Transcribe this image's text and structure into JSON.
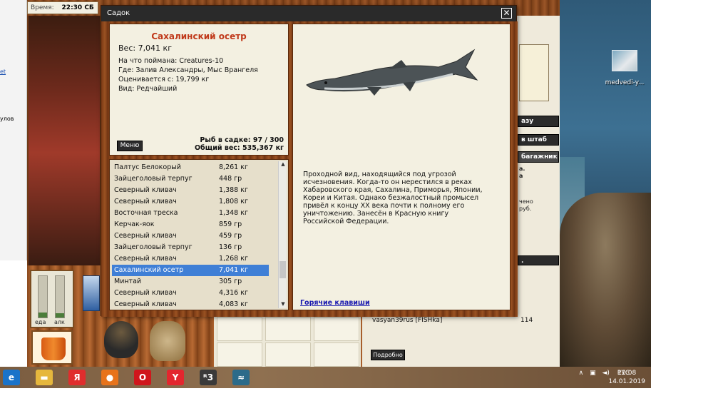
{
  "left_window": {
    "lines": [
      "et",
      "улов"
    ]
  },
  "game": {
    "time_label": "Время:",
    "time_value": "22:30 СБ",
    "gauges": [
      {
        "label": "еда",
        "level": 0.12
      },
      {
        "label": "алк",
        "level": 0.1
      }
    ],
    "right_buttons": [
      "азу",
      "в штаб",
      "багажник"
    ],
    "right_info": [
      "а.",
      "а",
      "чено",
      "руб."
    ],
    "bottom_list": {
      "player": "vasyan39rus [FISHka]",
      "count": "114",
      "button": "Подробно"
    }
  },
  "dialog": {
    "title": "Садок",
    "close_label": "✕",
    "fish": {
      "name": "Сахалинский осетр",
      "weight": "Вес: 7,041 кг",
      "caught_on": "На что поймана: Creatures-10",
      "location": "Где: Залив Александры, Мыс Врангеля",
      "valued": "Оценивается с: 19,799 кг",
      "kind": "Вид: Редчайший"
    },
    "menu_label": "Меню",
    "fish_in_pond": "Рыб в садке: 97 / 300",
    "total_weight": "Общий вес: 535,367 кг",
    "list": [
      {
        "name": "Палтус Белокорый",
        "weight": "8,261 кг"
      },
      {
        "name": "Зайцеголовый терпуг",
        "weight": "448 гр"
      },
      {
        "name": "Северный кливач",
        "weight": "1,388 кг"
      },
      {
        "name": "Северный кливач",
        "weight": "1,808 кг"
      },
      {
        "name": "Восточная треска",
        "weight": "1,348 кг"
      },
      {
        "name": "Керчак-яок",
        "weight": "859 гр"
      },
      {
        "name": "Северный кливач",
        "weight": "459 гр"
      },
      {
        "name": "Зайцеголовый терпуг",
        "weight": "136 гр"
      },
      {
        "name": "Северный кливач",
        "weight": "1,268 кг"
      },
      {
        "name": "Сахалинский осетр",
        "weight": "7,041 кг",
        "selected": true
      },
      {
        "name": "Минтай",
        "weight": "305 гр"
      },
      {
        "name": "Северный кливач",
        "weight": "4,316 кг"
      },
      {
        "name": "Северный кливач",
        "weight": "4,083 кг"
      }
    ],
    "description": "Проходной вид, находящийся под угрозой исчезновения.  Когда-то он нерестился в  реках Хабаровского края, Сахалина, Приморья, Японии, Кореи и Китая. Однако безжалостный промысел привёл к концу XX века почти к полному его уничтожению. Занесён в Красную книгу Российской Федерации.",
    "hotkeys_label": "Горячие клавиши"
  },
  "desktop": {
    "icon_label": "medvedi-y..."
  },
  "taskbar": {
    "apps": [
      {
        "name": "ie-icon",
        "glyph": "e",
        "color": "#1a73c9"
      },
      {
        "name": "folder-icon",
        "glyph": "▬",
        "color": "#e6b73d"
      },
      {
        "name": "yandex-browser-icon",
        "glyph": "Я",
        "color": "#e02d2d"
      },
      {
        "name": "firefox-icon",
        "glyph": "●",
        "color": "#e8731b"
      },
      {
        "name": "opera-icon",
        "glyph": "O",
        "color": "#d0161c"
      },
      {
        "name": "yandex-icon",
        "glyph": "Y",
        "color": "#e3262e"
      },
      {
        "name": "fishing-game-icon",
        "glyph": "ᴿ3",
        "color": "#3a3a3a"
      },
      {
        "name": "fish-app-icon",
        "glyph": "≈",
        "color": "#2c6b8a"
      }
    ],
    "lang": "РУС",
    "time": "11:08",
    "date": "14.01.2019"
  }
}
